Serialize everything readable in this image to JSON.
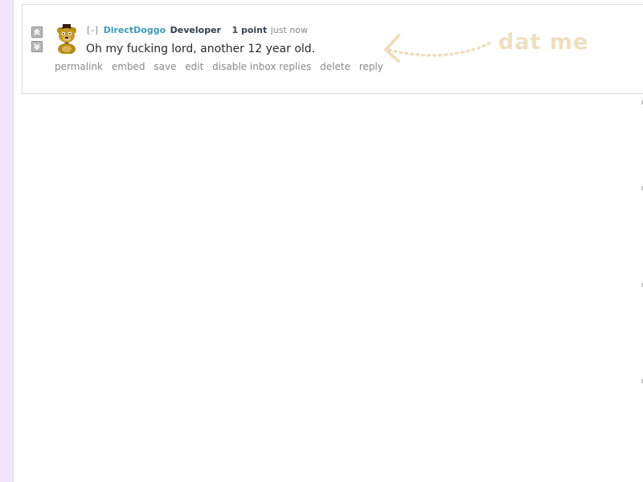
{
  "comment": {
    "collapse_label": "[–]",
    "author": "DirectDoggo",
    "flair": "Developer",
    "score": "1 point",
    "time": "just now",
    "body": "Oh my fucking lord, another 12 year old.",
    "buttons": [
      "permalink",
      "embed",
      "save",
      "edit",
      "disable inbox replies",
      "delete",
      "reply"
    ]
  },
  "annotation": {
    "text": "dat me",
    "color": "#eedfc0"
  },
  "colors": {
    "author": "#3b9bb3",
    "sidebar": "#f3e6fb"
  },
  "icons": {
    "upvote": "upvote-arrow-icon",
    "downvote": "downvote-arrow-icon",
    "avatar": "bear-avatar-icon"
  }
}
